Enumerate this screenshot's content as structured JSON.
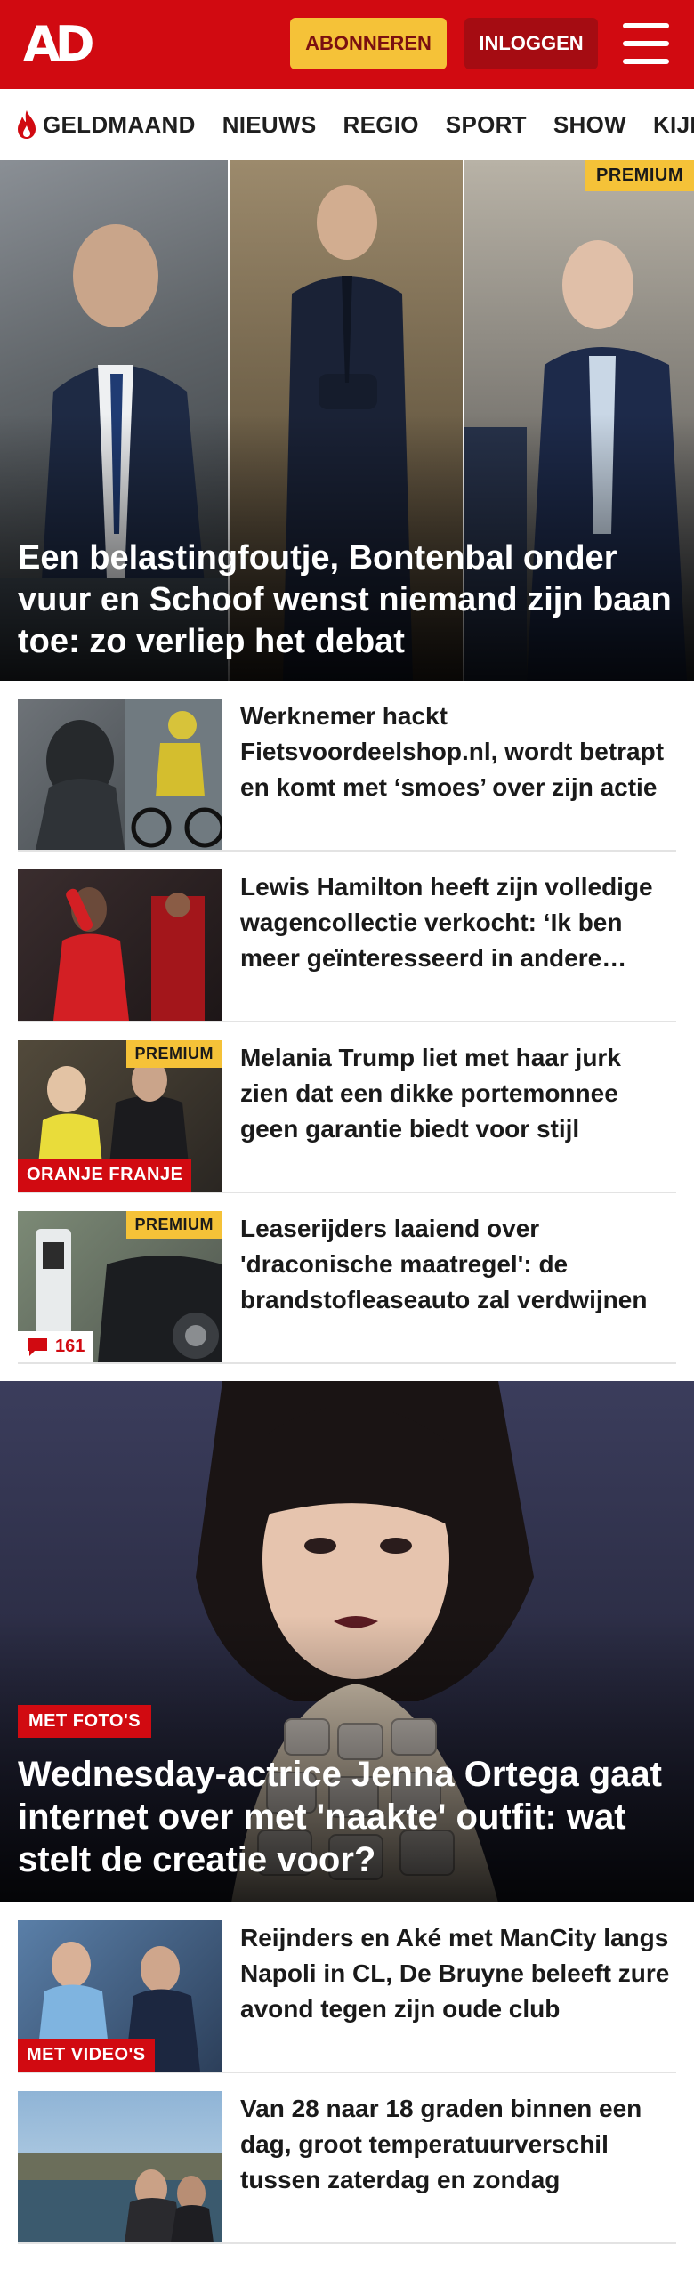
{
  "header": {
    "logo_text": "AD",
    "subscribe_label": "ABONNEREN",
    "login_label": "INLOGGEN",
    "menu_icon": "hamburger-menu-icon"
  },
  "nav": {
    "items": [
      "GELDMAAND",
      "NIEUWS",
      "REGIO",
      "SPORT",
      "SHOW",
      "KIJK"
    ],
    "first_icon": "flame-icon"
  },
  "hero": {
    "badge": "PREMIUM",
    "title": "Een belastingfoutje, Bontenbal onder vuur en Schoof wenst niemand zijn baan toe: zo verliep het debat"
  },
  "articles": [
    {
      "title": "Werknemer hackt Fietsvoordeelshop.nl, wordt betrapt en komt met ‘smoes’ over zijn actie",
      "premium": "",
      "label": "",
      "comments": ""
    },
    {
      "title": "Lewis Hamilton heeft zijn volledige wagencollectie verkocht: ‘Ik ben meer geïnteresseerd in andere dingen’",
      "premium": "",
      "label": "",
      "comments": ""
    },
    {
      "title": "Melania Trump liet met haar jurk zien dat een dikke portemonnee geen garantie biedt voor stijl",
      "premium": "PREMIUM",
      "label": "ORANJE FRANJE",
      "comments": ""
    },
    {
      "title": "Leaserijders laaiend over 'draconische maatregel': de brandstofleaseauto zal verdwijnen",
      "premium": "PREMIUM",
      "label": "",
      "comments": "161"
    }
  ],
  "hero2": {
    "label": "MET FOTO'S",
    "title": "Wednesday-actrice Jenna Ortega gaat internet over met 'naakte' outfit: wat stelt de creatie voor?"
  },
  "articles2": [
    {
      "title": "Reijnders en Aké met ManCity langs Napoli in CL, De Bruyne beleeft zure avond tegen zijn oude club",
      "label": "MET VIDEO'S"
    },
    {
      "title": "Van 28 naar 18 graden binnen een dag, groot temperatuurverschil tussen zaterdag en zondag",
      "label": ""
    }
  ],
  "colors": {
    "brand_red": "#d10a11",
    "premium_yellow": "#f5c238"
  }
}
